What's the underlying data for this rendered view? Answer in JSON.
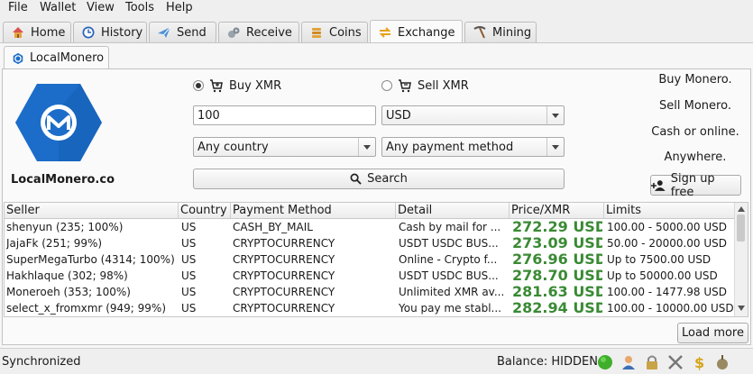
{
  "menubar": {
    "items": [
      "File",
      "Wallet",
      "View",
      "Tools",
      "Help"
    ]
  },
  "tabs": [
    {
      "label": "Home",
      "icon": "home-icon"
    },
    {
      "label": "History",
      "icon": "history-icon"
    },
    {
      "label": "Send",
      "icon": "send-icon"
    },
    {
      "label": "Receive",
      "icon": "receive-icon"
    },
    {
      "label": "Coins",
      "icon": "coins-icon"
    },
    {
      "label": "Exchange",
      "icon": "exchange-icon"
    },
    {
      "label": "Mining",
      "icon": "pickaxe-icon"
    }
  ],
  "subtab": {
    "label": "LocalMonero"
  },
  "brand": {
    "name": "LocalMonero.co",
    "logo_color": "#1c6dc9"
  },
  "form": {
    "buy_label": "Buy XMR",
    "sell_label": "Sell XMR",
    "buy_selected": true,
    "amount": "100",
    "currency": "USD",
    "country": "Any country",
    "payment_method": "Any payment method",
    "search_label": "Search"
  },
  "promo": {
    "lines": [
      "Buy Monero.",
      "Sell Monero.",
      "Cash or online.",
      "Anywhere."
    ],
    "signup_label": "Sign up free"
  },
  "table": {
    "headers": [
      "Seller",
      "Country",
      "Payment Method",
      "Detail",
      "Price/XMR",
      "Limits"
    ],
    "rows": [
      {
        "seller": "shenyun (235; 100%)",
        "country": "US",
        "method": "CASH_BY_MAIL",
        "detail": "Cash by mail for ...",
        "price": "272.29 USD",
        "limits": "100.00 - 5000.00 USD"
      },
      {
        "seller": "JajaFk (251; 99%)",
        "country": "US",
        "method": "CRYPTOCURRENCY",
        "detail": "USDT USDC BUS...",
        "price": "273.09 USD",
        "limits": "50.00 - 20000.00 USD"
      },
      {
        "seller": "SuperMegaTurbo (4314; 100%)",
        "country": "US",
        "method": "CRYPTOCURRENCY",
        "detail": "Online   - Crypto f...",
        "price": "276.96 USD",
        "limits": "Up to 7500.00 USD"
      },
      {
        "seller": "Hakhlaque (302; 98%)",
        "country": "US",
        "method": "CRYPTOCURRENCY",
        "detail": "USDT  USDC  BUS...",
        "price": "278.70 USD",
        "limits": "Up to 50000.00 USD"
      },
      {
        "seller": "Moneroeh (353; 100%)",
        "country": "US",
        "method": "CRYPTOCURRENCY",
        "detail": "Unlimited XMR av...",
        "price": "281.63 USD",
        "limits": "100.00 - 1477.98 USD"
      },
      {
        "seller": "select_x_fromxmr (949; 99%)",
        "country": "US",
        "method": "CRYPTOCURRENCY",
        "detail": "You pay me stabl...",
        "price": "282.94 USD",
        "limits": "100.00 - 10000.00 USD"
      }
    ]
  },
  "load_more_label": "Load more",
  "status": {
    "text": "Synchronized",
    "balance": "Balance: HIDDEN",
    "price_color": "#3a8a34"
  }
}
